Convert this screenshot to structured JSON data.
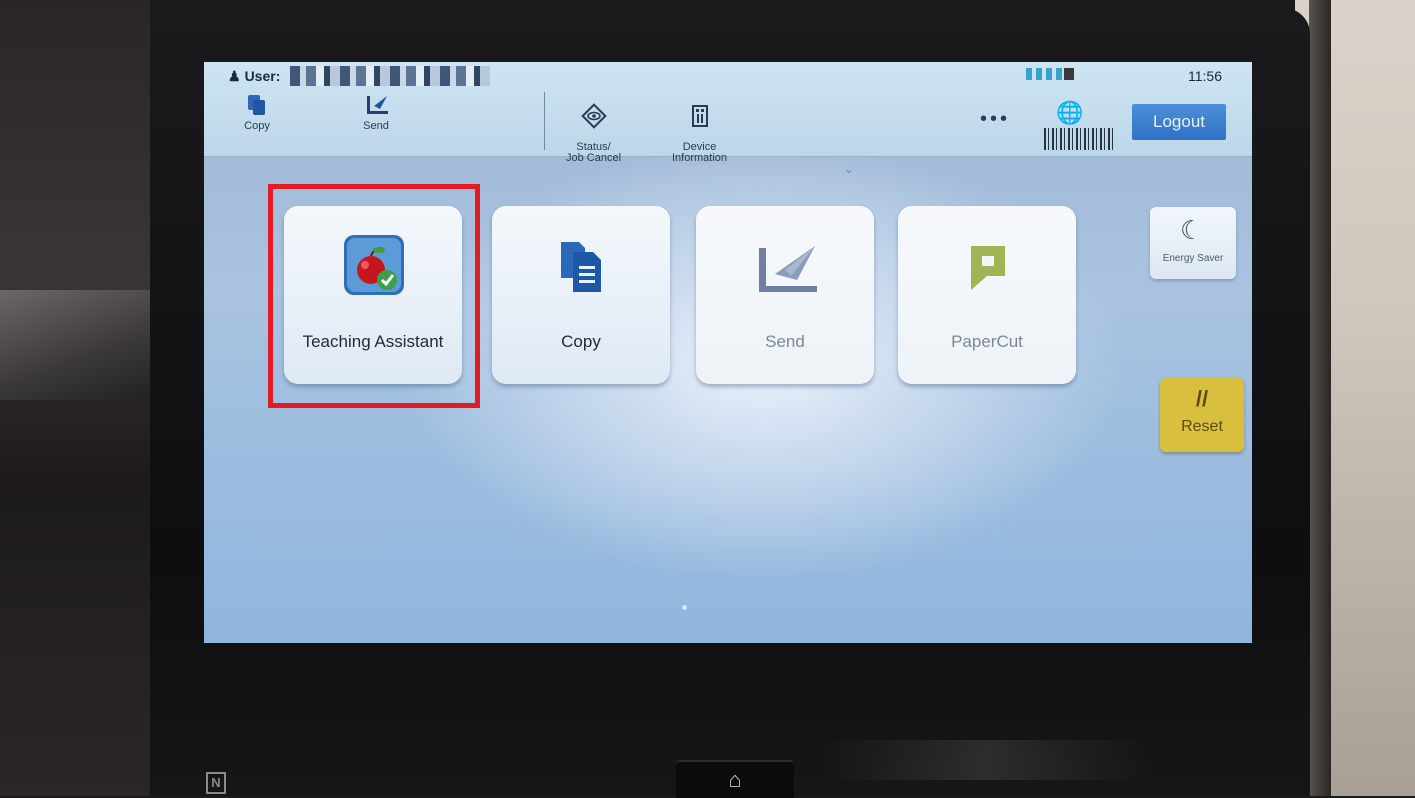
{
  "header": {
    "user_label": "User:",
    "time": "11:56",
    "logout_label": "Logout",
    "more_label": "•••"
  },
  "quick_buttons": [
    {
      "label": "Copy",
      "icon": "copy-icon"
    },
    {
      "label": "Send",
      "icon": "send-icon"
    },
    {
      "label": "Status/\nJob Cancel",
      "icon": "eye-icon"
    },
    {
      "label": "Device\nInformation",
      "icon": "device-info-icon"
    }
  ],
  "apps": [
    {
      "label": "Teaching Assistant",
      "icon": "apple-checkmark-icon",
      "highlighted": true
    },
    {
      "label": "Copy",
      "icon": "copy-icon"
    },
    {
      "label": "Send",
      "icon": "send-icon"
    },
    {
      "label": "PaperCut",
      "icon": "papercut-icon"
    }
  ],
  "side": {
    "energy_saver_label": "Energy Saver",
    "reset_label": "Reset"
  },
  "colors": {
    "highlight": "#e31b23",
    "logout_bg": "#2f72c3",
    "reset_bg": "#d9bf3e",
    "papercut_green": "#8aa832"
  }
}
